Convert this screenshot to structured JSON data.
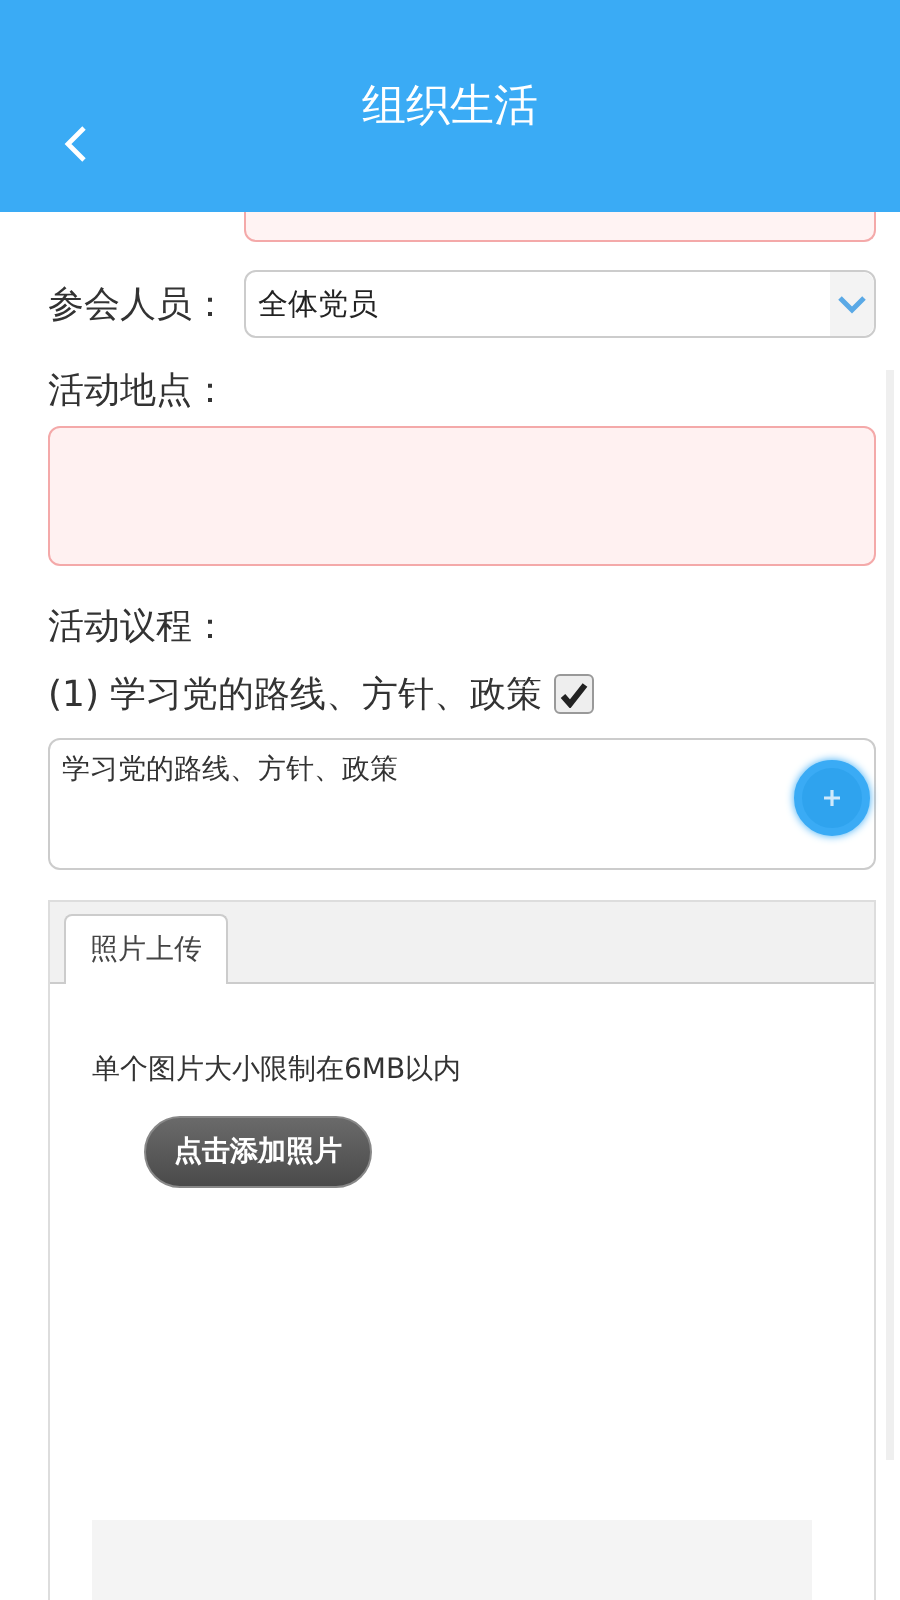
{
  "header": {
    "title": "组织生活"
  },
  "form": {
    "attendees": {
      "label": "参会人员：",
      "value": "全体党员"
    },
    "location": {
      "label": "活动地点：",
      "required": true
    },
    "agenda": {
      "label": "活动议程：",
      "items": [
        {
          "label": "(1) 学习党的路线、方针、政策",
          "checked": true,
          "text": "学习党的路线、方针、政策"
        }
      ]
    }
  },
  "upload": {
    "tabs": [
      {
        "label": "照片上传",
        "selected": true
      }
    ],
    "note": "单个图片大小限制在6MB以内",
    "button": "点击添加照片"
  }
}
